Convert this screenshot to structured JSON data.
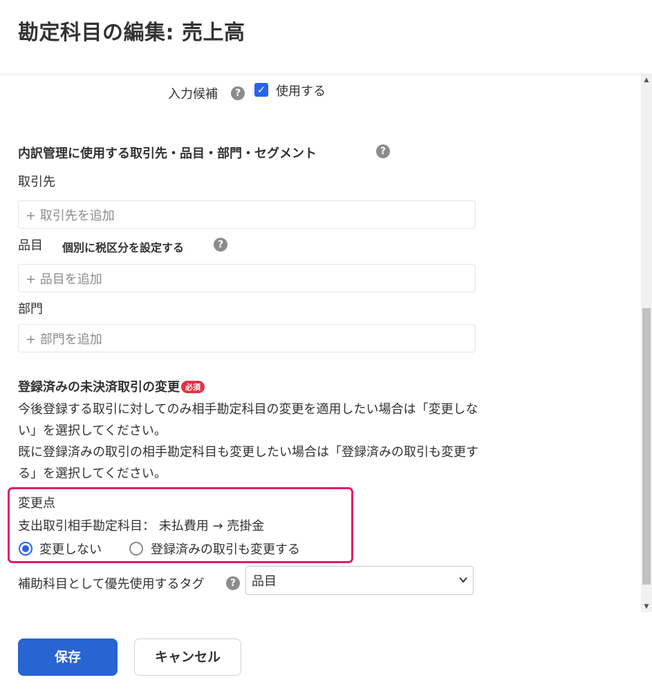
{
  "header": {
    "title": "勘定科目の編集: 売上高"
  },
  "candidate": {
    "label": "入力候補",
    "checkbox_label": "使用する",
    "checked": true
  },
  "breakdown": {
    "title": "内訳管理に使用する取引先・品目・部門・セグメント",
    "partner_label": "取引先",
    "partner_placeholder": "+ 取引先を追加",
    "item_label": "品目",
    "item_tax_label": "個別に税区分を設定する",
    "item_placeholder": "+ 品目を追加",
    "section_label": "部門",
    "section_placeholder": "+ 部門を追加"
  },
  "change": {
    "title": "登録済みの未決済取引の変更",
    "required_badge": "必須",
    "desc_line1": "今後登録する取引に対してのみ相手勘定科目の変更を適用したい場合は「変更しな",
    "desc_line2": "い」を選択してください。",
    "desc_line3": "既に登録済みの取引の相手勘定科目も変更したい場合は「登録済みの取引も変更す",
    "desc_line4": "る」を選択してください。",
    "change_point_label": "変更点",
    "change_detail": "支出取引相手勘定科目： 未払費用 → 売掛金",
    "options": [
      {
        "label": "変更しない",
        "selected": true
      },
      {
        "label": "登録済みの取引も変更する",
        "selected": false
      }
    ]
  },
  "tag": {
    "label": "補助科目として優先使用するタグ",
    "selected_value": "品目"
  },
  "footer": {
    "save_label": "保存",
    "cancel_label": "キャンセル"
  },
  "colors": {
    "accent": "#2864f0",
    "save_button": "#2864d2",
    "highlight_border": "#e6166d",
    "required_badge": "#dc3545"
  }
}
